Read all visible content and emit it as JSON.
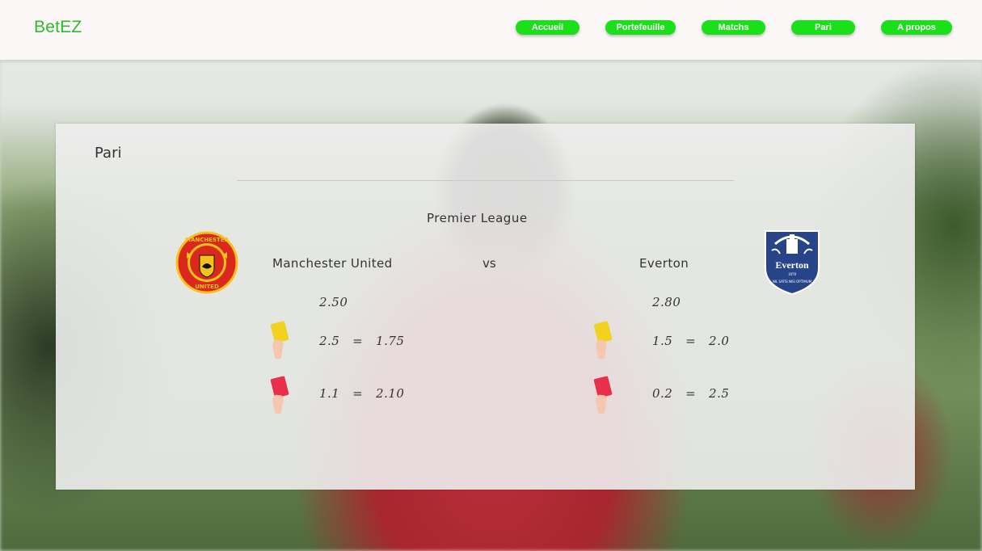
{
  "brand": {
    "name": "BetEZ",
    "color": "#2dbb2d"
  },
  "nav": {
    "accent": "#19e019",
    "items": [
      {
        "label": "Accueil"
      },
      {
        "label": "Portefeuille"
      },
      {
        "label": "Matchs"
      },
      {
        "label": "Pari"
      },
      {
        "label": "A propos"
      }
    ]
  },
  "bet": {
    "title": "Pari",
    "league": "Premier League",
    "vs_label": "vs",
    "home": {
      "name": "Manchester United",
      "crest_icon": "manchester-united-crest-icon",
      "crest_text_top": "MANCHESTER",
      "crest_text_bottom": "UNITED",
      "win_odds": "2.50",
      "yellow_cards": "2.5   =   1.75",
      "red_cards": "1.1   =   2.10"
    },
    "away": {
      "name": "Everton",
      "crest_icon": "everton-crest-icon",
      "crest_text": "Everton",
      "crest_year": "1878",
      "crest_motto": "NIL SATIS NISI OPTIMUM",
      "win_odds": "2.80",
      "yellow_cards": "1.5   =   2.0",
      "red_cards": "0.2   =   2.5"
    }
  }
}
